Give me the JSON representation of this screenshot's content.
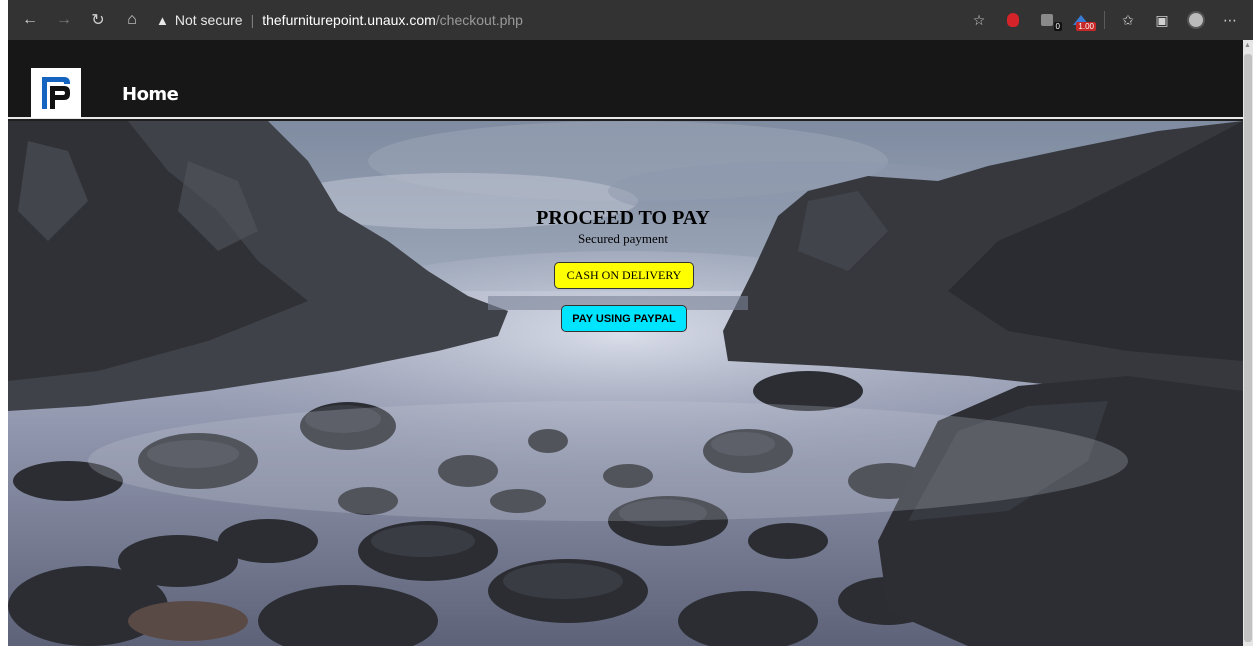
{
  "browser": {
    "security_label": "Not secure",
    "url_host": "thefurniturepoint.unaux.com",
    "url_path": "/checkout.php",
    "ext_badge_1": "0",
    "ext_badge_2": "1.00"
  },
  "site": {
    "nav_home": "Home"
  },
  "checkout": {
    "title": "PROCEED TO PAY",
    "subtitle": "Secured payment",
    "cod_button": "CASH ON DELIVERY",
    "paypal_button": "PAY USING PAYPAL"
  },
  "colors": {
    "cod_bg": "#ffff00",
    "paypal_bg": "#00e5ff",
    "header_bg": "#171717",
    "chrome_bg": "#333333"
  }
}
